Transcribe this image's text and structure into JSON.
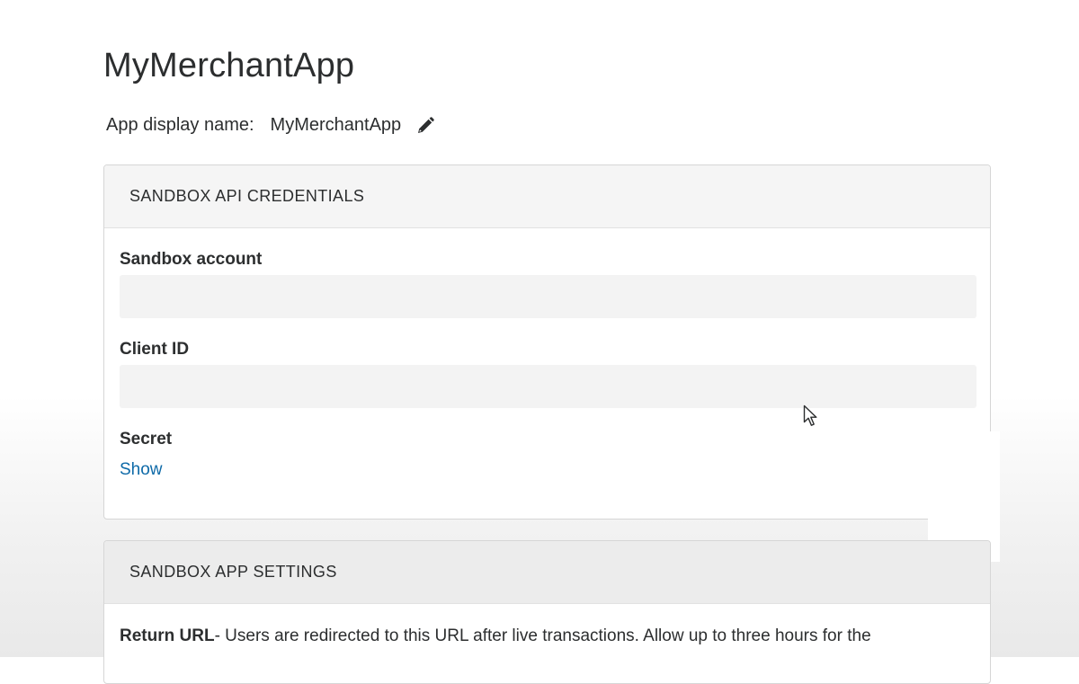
{
  "app": {
    "title": "MyMerchantApp"
  },
  "display_name": {
    "label": "App display name:",
    "value": "MyMerchantApp",
    "edit_icon": "pencil-icon"
  },
  "credentials": {
    "header": "SANDBOX API CREDENTIALS",
    "sandbox_account_label": "Sandbox account",
    "sandbox_account_value": "",
    "client_id_label": "Client ID",
    "client_id_value": "",
    "secret_label": "Secret",
    "show_label": "Show"
  },
  "settings": {
    "header": "SANDBOX APP SETTINGS",
    "return_url_label": "Return URL",
    "return_url_text": "- Users are redirected to this URL after live transactions. Allow up to three hours for the"
  },
  "colors": {
    "link": "#0e6aa8",
    "text": "#2c2e2f",
    "panel_header_bg": "#f5f5f5",
    "field_bg": "#f3f3f3"
  }
}
